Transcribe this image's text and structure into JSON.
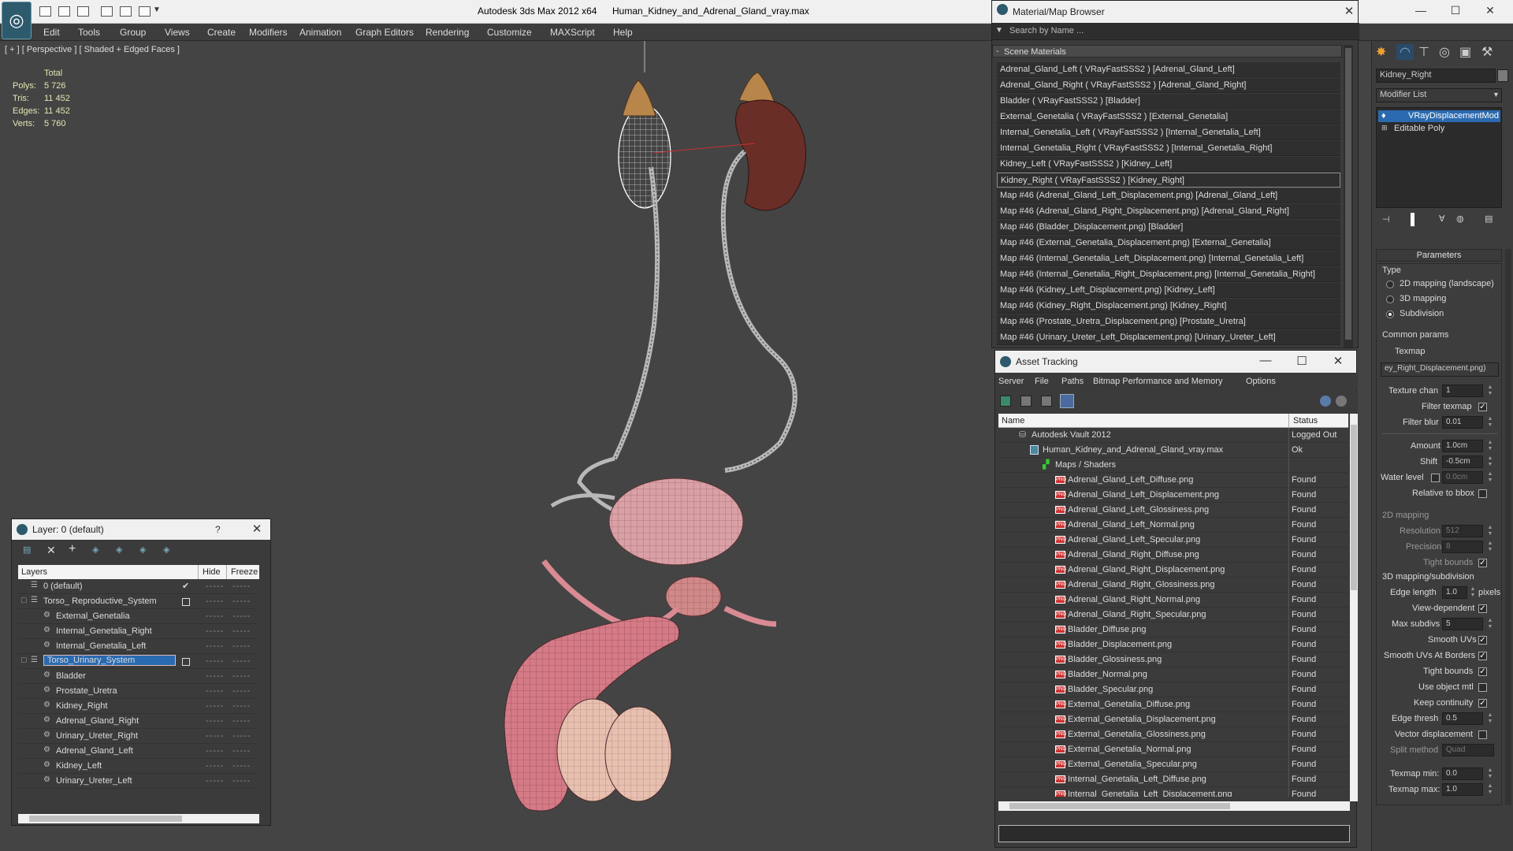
{
  "app": {
    "title": "Autodesk 3ds Max  2012 x64",
    "file": "Human_Kidney_and_Adrenal_Gland_vray.max"
  },
  "menu": [
    "Edit",
    "Tools",
    "Group",
    "Views",
    "Create",
    "Modifiers",
    "Animation",
    "Graph Editors",
    "Rendering",
    "Customize",
    "MAXScript",
    "Help"
  ],
  "viewport": {
    "label": "[ + ] [ Perspective ] [ Shaded + Edged Faces ]",
    "stats": {
      "header": "Total",
      "polys_label": "Polys:",
      "polys": "5 726",
      "tris_label": "Tris:",
      "tris": "11 452",
      "edges_label": "Edges:",
      "edges": "11 452",
      "verts_label": "Verts:",
      "verts": "5 760"
    }
  },
  "material_browser": {
    "title": "Material/Map Browser",
    "search_placeholder": "Search by Name ...",
    "section": "Scene Materials",
    "items": [
      "Adrenal_Gland_Left  ( VRayFastSSS2 ) [Adrenal_Gland_Left]",
      "Adrenal_Gland_Right  ( VRayFastSSS2 ) [Adrenal_Gland_Right]",
      "Bladder  ( VRayFastSSS2 ) [Bladder]",
      "External_Genetalia  ( VRayFastSSS2 ) [External_Genetalia]",
      "Internal_Genetalia_Left  ( VRayFastSSS2 ) [Internal_Genetalia_Left]",
      "Internal_Genetalia_Right  ( VRayFastSSS2 ) [Internal_Genetalia_Right]",
      "Kidney_Left  ( VRayFastSSS2 ) [Kidney_Left]",
      "Kidney_Right  ( VRayFastSSS2 ) [Kidney_Right]",
      "Map #46 (Adrenal_Gland_Left_Displacement.png) [Adrenal_Gland_Left]",
      "Map #46 (Adrenal_Gland_Right_Displacement.png) [Adrenal_Gland_Right]",
      "Map #46 (Bladder_Displacement.png) [Bladder]",
      "Map #46 (External_Genetalia_Displacement.png) [External_Genetalia]",
      "Map #46 (Internal_Genetalia_Left_Displacement.png) [Internal_Genetalia_Left]",
      "Map #46 (Internal_Genetalia_Right_Displacement.png) [Internal_Genetalia_Right]",
      "Map #46 (Kidney_Left_Displacement.png) [Kidney_Left]",
      "Map #46 (Kidney_Right_Displacement.png) [Kidney_Right]",
      "Map #46 (Prostate_Uretra_Displacement.png) [Prostate_Uretra]",
      "Map #46 (Urinary_Ureter_Left_Displacement.png) [Urinary_Ureter_Left]"
    ],
    "selected_index": 7
  },
  "asset_tracking": {
    "title": "Asset Tracking",
    "menu": [
      "Server",
      "File",
      "Paths",
      "Bitmap Performance and Memory",
      "Options"
    ],
    "col_name": "Name",
    "col_status": "Status",
    "rows": [
      {
        "name": "Autodesk Vault 2012",
        "status": "Logged Out",
        "level": 0,
        "kind": "vault"
      },
      {
        "name": "Human_Kidney_and_Adrenal_Gland_vray.max",
        "status": "Ok",
        "level": 1,
        "kind": "max"
      },
      {
        "name": "Maps / Shaders",
        "status": "",
        "level": 2,
        "kind": "folder"
      },
      {
        "name": "Adrenal_Gland_Left_Diffuse.png",
        "status": "Found",
        "level": 3,
        "kind": "png"
      },
      {
        "name": "Adrenal_Gland_Left_Displacement.png",
        "status": "Found",
        "level": 3,
        "kind": "png"
      },
      {
        "name": "Adrenal_Gland_Left_Glossiness.png",
        "status": "Found",
        "level": 3,
        "kind": "png"
      },
      {
        "name": "Adrenal_Gland_Left_Normal.png",
        "status": "Found",
        "level": 3,
        "kind": "png"
      },
      {
        "name": "Adrenal_Gland_Left_Specular.png",
        "status": "Found",
        "level": 3,
        "kind": "png"
      },
      {
        "name": "Adrenal_Gland_Right_Diffuse.png",
        "status": "Found",
        "level": 3,
        "kind": "png"
      },
      {
        "name": "Adrenal_Gland_Right_Displacement.png",
        "status": "Found",
        "level": 3,
        "kind": "png"
      },
      {
        "name": "Adrenal_Gland_Right_Glossiness.png",
        "status": "Found",
        "level": 3,
        "kind": "png"
      },
      {
        "name": "Adrenal_Gland_Right_Normal.png",
        "status": "Found",
        "level": 3,
        "kind": "png"
      },
      {
        "name": "Adrenal_Gland_Right_Specular.png",
        "status": "Found",
        "level": 3,
        "kind": "png"
      },
      {
        "name": "Bladder_Diffuse.png",
        "status": "Found",
        "level": 3,
        "kind": "png"
      },
      {
        "name": "Bladder_Displacement.png",
        "status": "Found",
        "level": 3,
        "kind": "png"
      },
      {
        "name": "Bladder_Glossiness.png",
        "status": "Found",
        "level": 3,
        "kind": "png"
      },
      {
        "name": "Bladder_Normal.png",
        "status": "Found",
        "level": 3,
        "kind": "png"
      },
      {
        "name": "Bladder_Specular.png",
        "status": "Found",
        "level": 3,
        "kind": "png"
      },
      {
        "name": "External_Genetalia_Diffuse.png",
        "status": "Found",
        "level": 3,
        "kind": "png"
      },
      {
        "name": "External_Genetalia_Displacement.png",
        "status": "Found",
        "level": 3,
        "kind": "png"
      },
      {
        "name": "External_Genetalia_Glossiness.png",
        "status": "Found",
        "level": 3,
        "kind": "png"
      },
      {
        "name": "External_Genetalia_Normal.png",
        "status": "Found",
        "level": 3,
        "kind": "png"
      },
      {
        "name": "External_Genetalia_Specular.png",
        "status": "Found",
        "level": 3,
        "kind": "png"
      },
      {
        "name": "Internal_Genetalia_Left_Diffuse.png",
        "status": "Found",
        "level": 3,
        "kind": "png"
      },
      {
        "name": "Internal_Genetalia_Left_Displacement.png",
        "status": "Found",
        "level": 3,
        "kind": "png"
      }
    ]
  },
  "layer_panel": {
    "title": "Layer: 0 (default)",
    "help": "?",
    "col_layers": "Layers",
    "col_hide": "Hide",
    "col_freeze": "Freeze",
    "rows": [
      {
        "name": "0 (default)",
        "level": 0,
        "kind": "layer",
        "check": true
      },
      {
        "name": "Torso_ Reproductive_System",
        "level": 0,
        "kind": "layer",
        "box": true,
        "expand": "-"
      },
      {
        "name": "External_Genetalia",
        "level": 1,
        "kind": "obj"
      },
      {
        "name": "Internal_Genetalia_Right",
        "level": 1,
        "kind": "obj"
      },
      {
        "name": "Internal_Genetalia_Left",
        "level": 1,
        "kind": "obj"
      },
      {
        "name": "Torso_Urinary_System",
        "level": 0,
        "kind": "layer",
        "box": true,
        "selected": true,
        "expand": "-"
      },
      {
        "name": "Bladder",
        "level": 1,
        "kind": "obj"
      },
      {
        "name": "Prostate_Uretra",
        "level": 1,
        "kind": "obj"
      },
      {
        "name": "Kidney_Right",
        "level": 1,
        "kind": "obj"
      },
      {
        "name": "Adrenal_Gland_Right",
        "level": 1,
        "kind": "obj"
      },
      {
        "name": "Urinary_Ureter_Right",
        "level": 1,
        "kind": "obj"
      },
      {
        "name": "Adrenal_Gland_Left",
        "level": 1,
        "kind": "obj"
      },
      {
        "name": "Kidney_Left",
        "level": 1,
        "kind": "obj"
      },
      {
        "name": "Urinary_Ureter_Left",
        "level": 1,
        "kind": "obj"
      }
    ],
    "dots": "-----"
  },
  "command_panel": {
    "object_name": "Kidney_Right",
    "modifier_list": "Modifier List",
    "stack": [
      "VRayDisplacementMod",
      "Editable Poly"
    ],
    "rollout": "Parameters",
    "type_label": "Type",
    "type_options": [
      "2D mapping (landscape)",
      "3D mapping",
      "Subdivision"
    ],
    "type_selected": 2,
    "common_params": "Common params",
    "texmap_label": "Texmap",
    "texmap_value": "ey_Right_Displacement.png)",
    "texture_chan_label": "Texture chan",
    "texture_chan": "1",
    "filter_texmap_label": "Filter texmap",
    "filter_blur_label": "Filter blur",
    "filter_blur": "0.01",
    "amount_label": "Amount",
    "amount": "1.0cm",
    "shift_label": "Shift",
    "shift": "-0.5cm",
    "water_level_label": "Water level",
    "water_level": "0.0cm",
    "relative_bbox_label": "Relative to bbox",
    "mapping2d": "2D mapping",
    "resolution_label": "Resolution",
    "resolution": "512",
    "precision_label": "Precision",
    "precision": "8",
    "tight_bounds_label": "Tight bounds",
    "mapping3d": "3D mapping/subdivision",
    "edge_length_label": "Edge length",
    "edge_length": "1.0",
    "pixels_label": "pixels",
    "view_dependent_label": "View-dependent",
    "max_subdivs_label": "Max subdivs",
    "max_subdivs": "5",
    "smooth_uvs_label": "Smooth UVs",
    "smooth_uvs_borders_label": "Smooth UVs At Borders",
    "tight_bounds2_label": "Tight bounds",
    "use_object_mtl_label": "Use object mtl",
    "keep_continuity_label": "Keep continuity",
    "edge_thresh_label": "Edge thresh",
    "edge_thresh": "0.5",
    "vector_disp_label": "Vector displacement",
    "split_method_label": "Split method",
    "split_method": "Quad",
    "texmap_min_label": "Texmap min:",
    "texmap_min": "0.0",
    "texmap_max_label": "Texmap max:",
    "texmap_max": "1.0"
  }
}
